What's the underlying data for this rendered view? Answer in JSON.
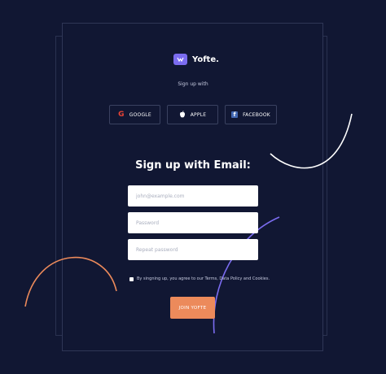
{
  "brand": {
    "name": "Yofte.",
    "accent": "#7b6cf0"
  },
  "signup_with": "Sign up with",
  "social": {
    "google": {
      "label": "GOOGLE",
      "icon": "google-icon"
    },
    "apple": {
      "label": "APPLE",
      "icon": "apple-icon"
    },
    "facebook": {
      "label": "FACEBOOK",
      "icon": "facebook-icon"
    }
  },
  "email_heading": "Sign up with Email:",
  "fields": {
    "email_placeholder": "john@example.com",
    "password_placeholder": "Password",
    "repeat_placeholder": "Repeat password"
  },
  "consent_text": "By singning up, you agree to our Terms, Data Policy and Cookies.",
  "join_label": "JOIN YOFTE",
  "colors": {
    "background": "#111733",
    "button": "#ec8a5b",
    "orange_arc": "#ec8a5b",
    "purple_arc": "#7b6cf0",
    "white_arc": "#ffffff"
  }
}
